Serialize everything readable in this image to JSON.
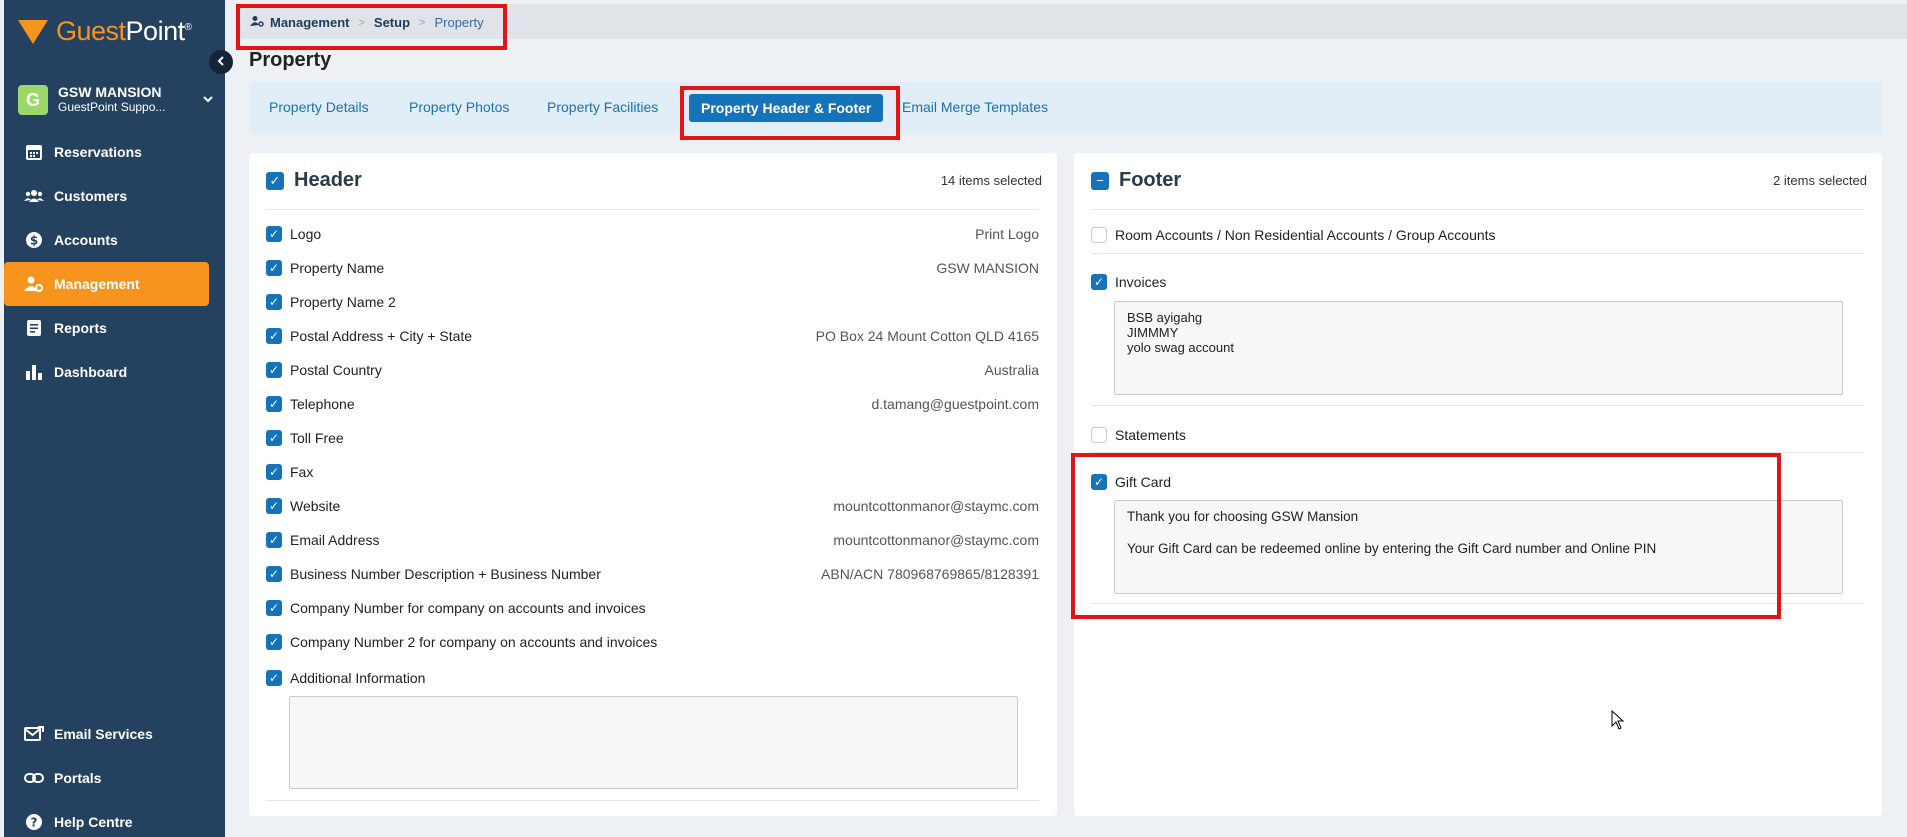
{
  "brand": {
    "name_a": "Guest",
    "name_b": "Point",
    "mark": "®"
  },
  "property_switcher": {
    "avatar_letter": "G",
    "name": "GSW MANSION",
    "sub": "GuestPoint Suppo..."
  },
  "nav": {
    "items": [
      {
        "label": "Reservations",
        "icon": "calendar-icon"
      },
      {
        "label": "Customers",
        "icon": "users-icon"
      },
      {
        "label": "Accounts",
        "icon": "dollar-icon"
      },
      {
        "label": "Management",
        "icon": "user-gear-icon",
        "active": true
      },
      {
        "label": "Reports",
        "icon": "report-icon"
      },
      {
        "label": "Dashboard",
        "icon": "bar-chart-icon"
      }
    ],
    "bottom": [
      {
        "label": "Email Services",
        "icon": "mail-icon"
      },
      {
        "label": "Portals",
        "icon": "link-icon"
      },
      {
        "label": "Help Centre",
        "icon": "help-icon"
      }
    ]
  },
  "breadcrumb": {
    "item1": "Management",
    "item2": "Setup",
    "item3": "Property"
  },
  "page": {
    "title": "Property"
  },
  "tabs": [
    "Property Details",
    "Property Photos",
    "Property Facilities",
    "Property Header & Footer",
    "Email Merge Templates"
  ],
  "header_card": {
    "title": "Header",
    "count": "14 items selected",
    "rows": [
      {
        "label": "Logo",
        "value": "Print Logo"
      },
      {
        "label": "Property Name",
        "value": "GSW MANSION"
      },
      {
        "label": "Property Name 2",
        "value": ""
      },
      {
        "label": "Postal Address + City + State",
        "value": "PO Box 24 Mount Cotton QLD 4165"
      },
      {
        "label": "Postal Country",
        "value": "Australia"
      },
      {
        "label": "Telephone",
        "value": "d.tamang@guestpoint.com"
      },
      {
        "label": "Toll Free",
        "value": ""
      },
      {
        "label": "Fax",
        "value": ""
      },
      {
        "label": "Website",
        "value": "mountcottonmanor@staymc.com"
      },
      {
        "label": "Email Address",
        "value": "mountcottonmanor@staymc.com"
      },
      {
        "label": "Business Number Description + Business Number",
        "value": "ABN/ACN 780968769865/8128391"
      },
      {
        "label": "Company Number for company on accounts and invoices",
        "value": ""
      },
      {
        "label": "Company Number 2 for company on accounts and invoices",
        "value": ""
      },
      {
        "label": "Additional Information",
        "value": ""
      }
    ],
    "additional_info_text": ""
  },
  "footer_card": {
    "title": "Footer",
    "count": "2 items selected",
    "room_accounts": {
      "label": "Room Accounts / Non Residential Accounts / Group Accounts",
      "checked": false
    },
    "invoices": {
      "label": "Invoices",
      "checked": true,
      "line1": "BSB ayigahg",
      "line2": "JIMMMY",
      "line3": "yolo swag account"
    },
    "statements": {
      "label": "Statements",
      "checked": false
    },
    "gift_card": {
      "label": "Gift Card",
      "checked": true,
      "line1": "Thank you for choosing GSW Mansion",
      "line2": "Your Gift Card can be redeemed online by entering the Gift Card number and Online PIN"
    }
  },
  "colors": {
    "sidebar": "#24425f",
    "accent": "#f7941d",
    "primary": "#1473b9",
    "highlight": "#e01515"
  }
}
